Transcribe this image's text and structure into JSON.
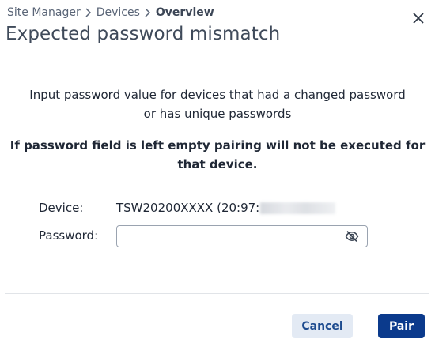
{
  "breadcrumb": {
    "items": [
      "Site Manager",
      "Devices"
    ],
    "current": "Overview"
  },
  "dialog": {
    "title": "Expected password mismatch",
    "info_line1": "Input password value for devices that had a changed password",
    "info_line2": "or has unique passwords",
    "warning_line1": "If password field is left empty pairing will not be executed for",
    "warning_line2": "that device."
  },
  "form": {
    "device_label": "Device:",
    "device_value": "TSW20200XXXX (20:97:",
    "password_label": "Password:",
    "password_value": "",
    "password_placeholder": ""
  },
  "buttons": {
    "cancel": "Cancel",
    "pair": "Pair"
  },
  "icons": {
    "close": "close-icon",
    "separator": "chevron-right-icon",
    "password_visibility": "eye-off-icon"
  },
  "colors": {
    "primary": "#0b3a8c",
    "secondary_bg": "#e3eaf4",
    "secondary_text": "#1d4b8f",
    "title": "#3f4a5a"
  }
}
